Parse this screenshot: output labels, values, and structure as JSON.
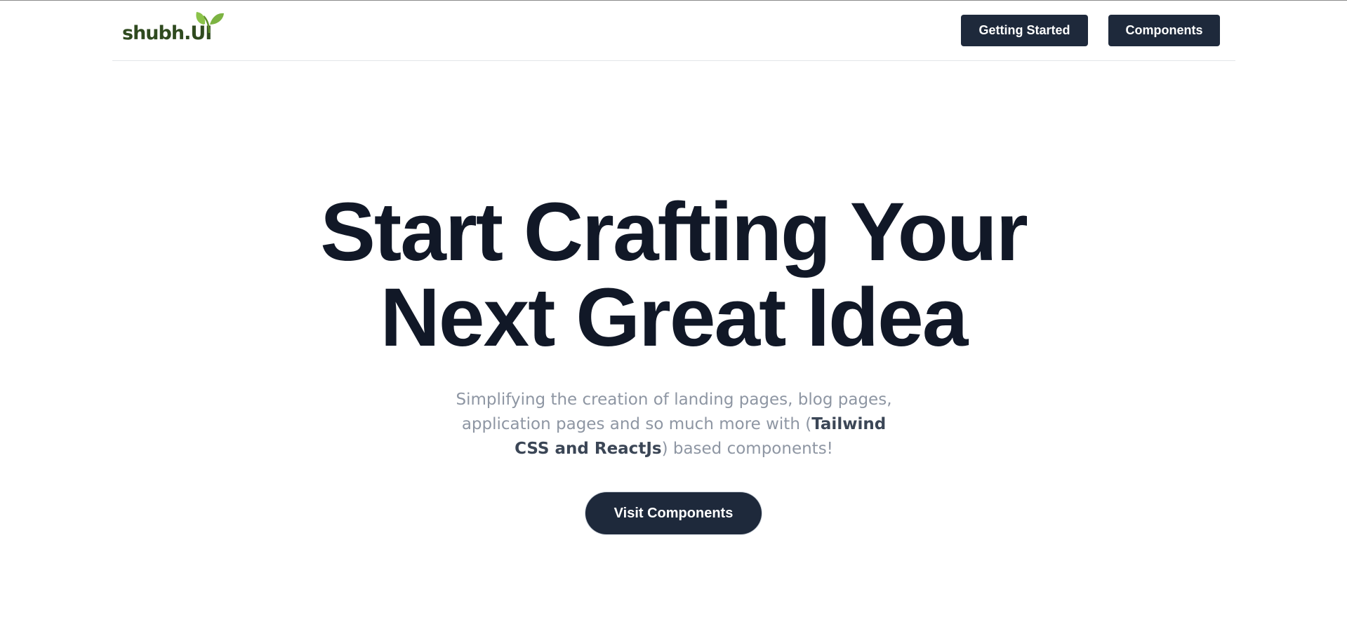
{
  "navbar": {
    "logo_text": "shubh.UI",
    "brand_color": "#2f4a1f",
    "leaf_color": "#7cb342",
    "getting_started_label": "Getting Started",
    "components_label": "Components",
    "button_color": "#1e293b"
  },
  "hero": {
    "title_line1": "Start Crafting Your",
    "title_line2": "Next Great Idea",
    "subtitle_part1": "Simplifying the creation of landing pages, blog pages, application pages and so much more with (",
    "subtitle_highlight": "Tailwind CSS and ReactJs",
    "subtitle_part2": ") based components!",
    "cta_label": "Visit Components"
  }
}
